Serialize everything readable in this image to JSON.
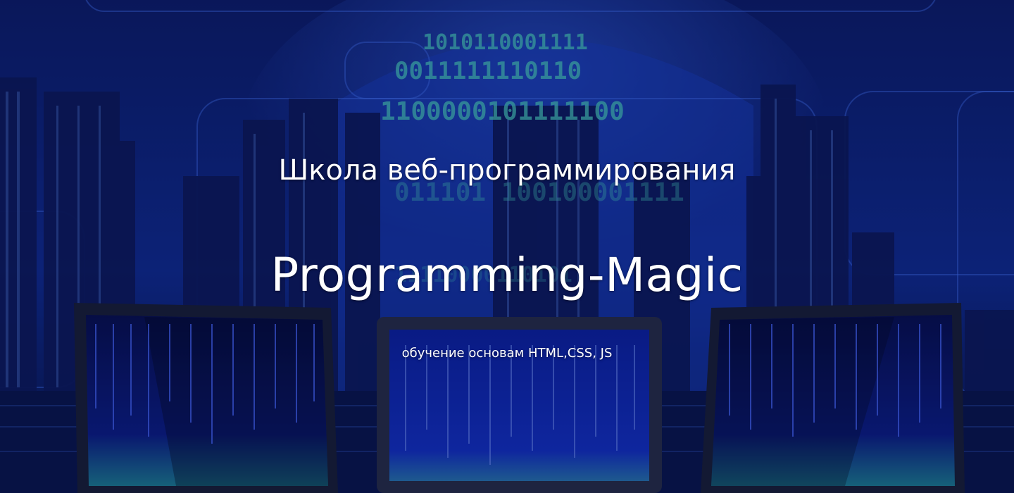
{
  "hero": {
    "school_title": "Школа веб-программирования",
    "brand_title": "Programming-Magic",
    "subtitle": "обучение основам HTML,CSS, JS"
  },
  "background": {
    "image_description_icon": "city-binary-laptops-image",
    "overlay_color": "#0a1450",
    "accent_color": "#2a5cff",
    "code_color": "#5ee0c8"
  }
}
